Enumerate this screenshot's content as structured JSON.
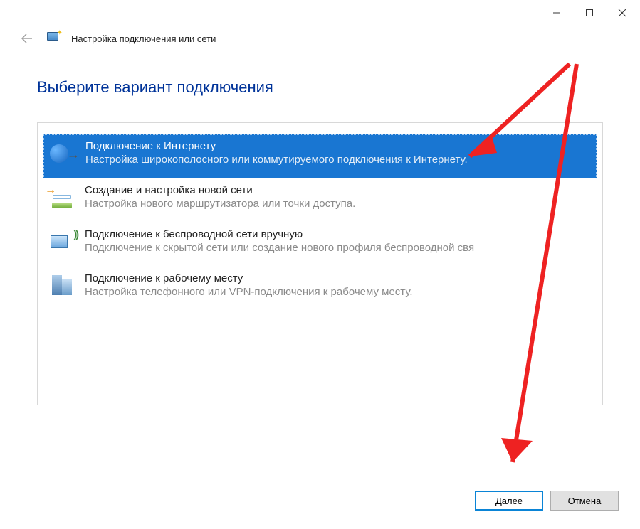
{
  "header": {
    "title": "Настройка подключения или сети"
  },
  "page": {
    "heading": "Выберите вариант подключения"
  },
  "options": [
    {
      "title": "Подключение к Интернету",
      "desc": "Настройка широкополосного или коммутируемого подключения к Интернету."
    },
    {
      "title": "Создание и настройка новой сети",
      "desc": "Настройка нового маршрутизатора или точки доступа."
    },
    {
      "title": "Подключение к беспроводной сети вручную",
      "desc": "Подключение к скрытой сети или создание нового профиля беспроводной свя"
    },
    {
      "title": "Подключение к рабочему месту",
      "desc": "Настройка телефонного или VPN-подключения к рабочему месту."
    }
  ],
  "footer": {
    "next": "Далее",
    "cancel": "Отмена"
  }
}
